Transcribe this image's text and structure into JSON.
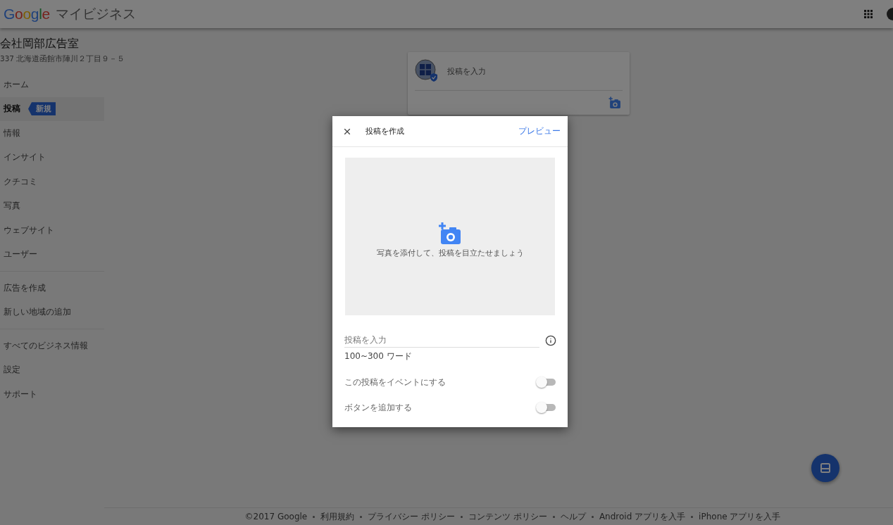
{
  "header": {
    "logo": "Google",
    "product": "マイビジネス"
  },
  "business": {
    "name": "会社岡部広告室",
    "address": "337 北海道函館市陣川２丁目９－５"
  },
  "sidebar": {
    "sections": [
      [
        {
          "label": "ホーム",
          "selected": false
        },
        {
          "label": "投稿",
          "selected": true,
          "badge": "新規"
        },
        {
          "label": "情報",
          "selected": false
        },
        {
          "label": "インサイト",
          "selected": false
        },
        {
          "label": "クチコミ",
          "selected": false
        },
        {
          "label": "写真",
          "selected": false
        },
        {
          "label": "ウェブサイト",
          "selected": false
        },
        {
          "label": "ユーザー",
          "selected": false
        }
      ],
      [
        {
          "label": "広告を作成",
          "selected": false
        },
        {
          "label": "新しい地域の追加",
          "selected": false
        }
      ],
      [
        {
          "label": "すべてのビジネス情報",
          "selected": false
        },
        {
          "label": "設定",
          "selected": false
        },
        {
          "label": "サポート",
          "selected": false
        }
      ]
    ]
  },
  "post_card": {
    "placeholder": "投稿を入力"
  },
  "dialog": {
    "open": true,
    "title": "投稿を作成",
    "preview": "プレビュー",
    "photo_hint": "写真を添付して、投稿を目立たせましょう",
    "input_placeholder": "投稿を入力",
    "helper": "100~300 ワード",
    "toggles": [
      {
        "label": "この投稿をイベントにする",
        "on": false
      },
      {
        "label": "ボタンを追加する",
        "on": false
      }
    ]
  },
  "footer": [
    "©2017 Google",
    "利用規約",
    "プライバシー ポリシー",
    "コンテンツ ポリシー",
    "ヘルプ",
    "Android アプリを入手",
    "iPhone アプリを入手"
  ]
}
